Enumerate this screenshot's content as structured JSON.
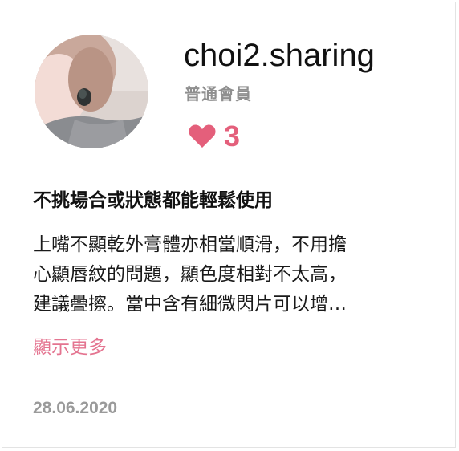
{
  "profile": {
    "username": "choi2.sharing",
    "role": "普通會員",
    "likes": "3"
  },
  "review": {
    "title": "不挑場合或狀態都能輕鬆使用",
    "lines": [
      "上嘴不顯乾外膏體亦相當順滑，不用擔",
      "心顯唇紋的問題，顯色度相對不太高，",
      "建議疊擦。當中含有細微閃片可以增…"
    ],
    "show_more": "顯示更多",
    "date": "28.06.2020"
  },
  "colors": {
    "accent": "#e45f7b",
    "link": "#e47490",
    "muted": "#9a9a9a"
  },
  "icons": {
    "like": "heart-icon"
  }
}
